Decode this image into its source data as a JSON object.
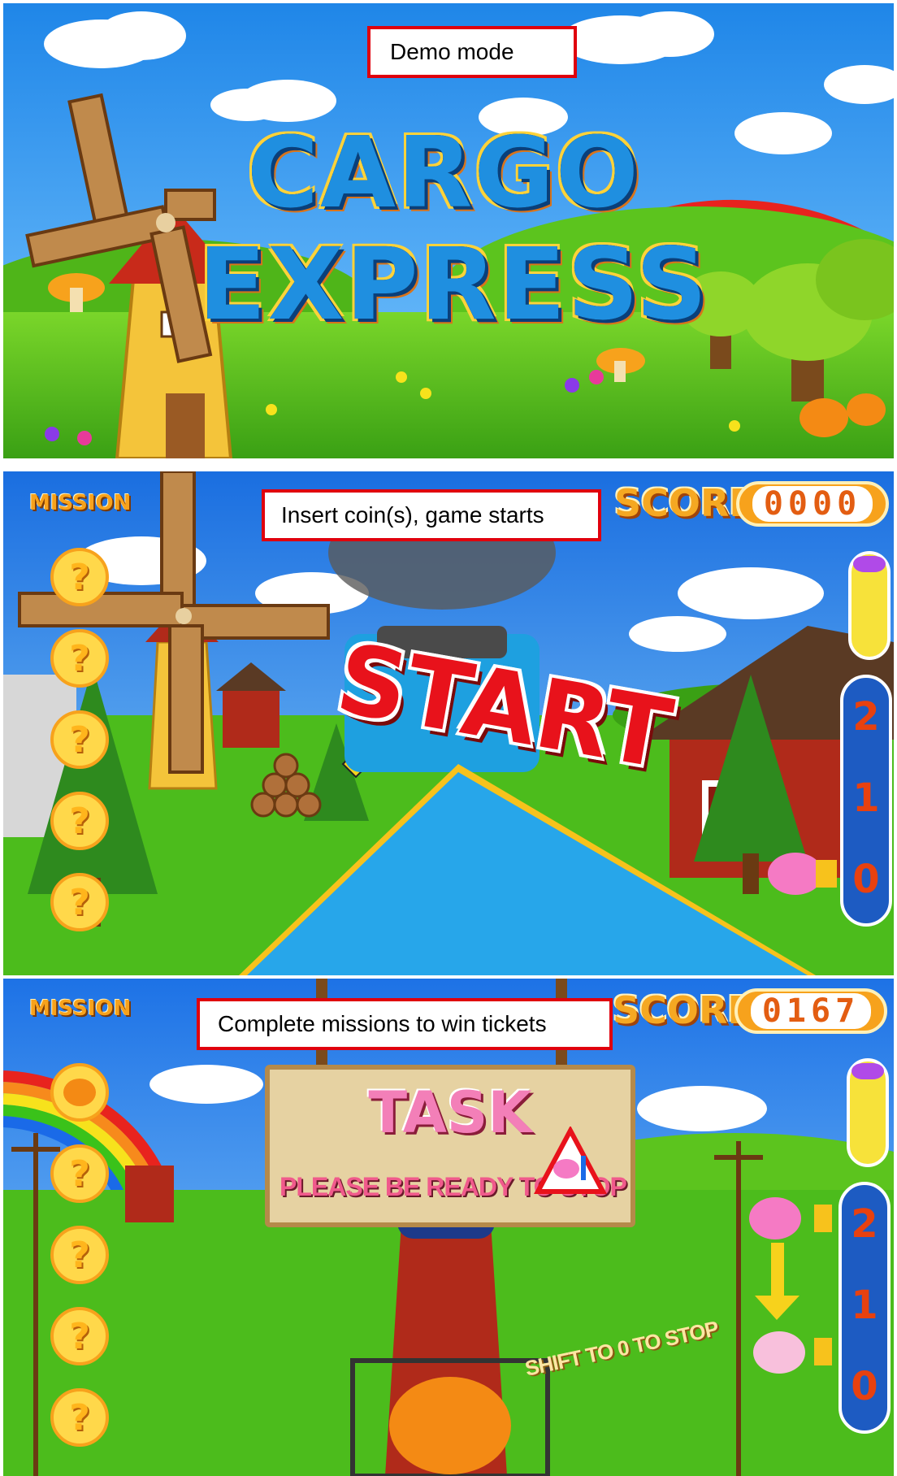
{
  "captions": {
    "demo": "Demo mode",
    "insert": "Insert coin(s), game starts",
    "complete": "Complete missions to win tickets"
  },
  "logo": {
    "line1": "CARGO",
    "line2": "EXPRESS"
  },
  "hud": {
    "mission_label": "MISSION",
    "score_label": "SCORE",
    "score_panel2": "0000",
    "score_panel3": "0167",
    "mission_slot_symbol": "?"
  },
  "gears": [
    "2",
    "1",
    "0"
  ],
  "start_text": "START",
  "task": {
    "title": "TASK",
    "subtitle": "PLEASE BE READY TO STOP",
    "hint": "SHIFT TO 0 TO STOP"
  },
  "colors": {
    "caption_border": "#e0000d",
    "sky": "#2a9af0",
    "grass": "#4cc21e",
    "score_orange": "#f7a21c",
    "gear_blue": "#1d5bc2"
  },
  "icons": [
    "windmill-icon",
    "rainbow-icon",
    "tree-icon",
    "pumpkin-icon",
    "lever-icon",
    "gear-indicator-icon",
    "question-flower-icon"
  ]
}
